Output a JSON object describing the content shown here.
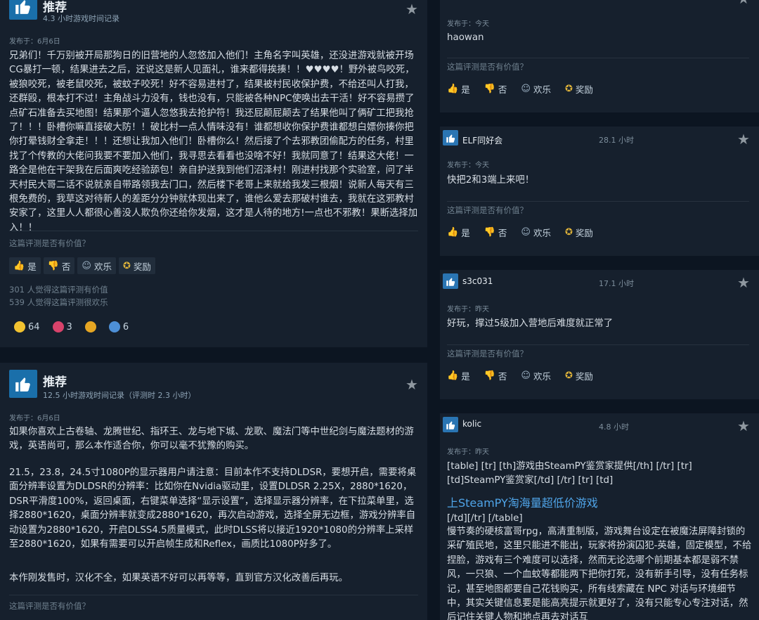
{
  "left": {
    "review1": {
      "recommend": "推荐",
      "hours": "4.3 小时游戏时间记录",
      "posted": "发布于：6月6日",
      "body": "兄弟们！千万别被开局那狗日的旧营地的人忽悠加入他们！主角名字叫英雄，还没进游戏就被开场CG暴打一顿，结果进去之后，还说这是新人见面礼，谁来都得挨揍！！♥♥♥♥！野外被鸟咬死，被狼咬死，被老鼠咬死，被蚊子咬死！好不容易进村了，结果被村民收保护费，不给还叫人打我，还群殴，根本打不过！主角战斗力没有，钱也没有，只能被各种NPC使唤出去干活！好不容易攒了点矿石准备去买地图！结果那个逼人忽悠我去抢护符！我还屁颠屁颠去了结果他叫了俩矿工把我抢了！！！卧槽你嘛直接破大防！！破比村一点人情味没有！谁都想收你保护费谁都想白嫖你揍你把你打晕钱财全拿走！！！还想让我加入他们！卧槽你么！然后接了个去邪教团偷配方的任务，村里找了个传教的大佬问我要不要加入他们，我寻思去看看也没啥不好！我就同意了！结果这大佬！一路全是他在干架我在后面爽吃经验舔包！亲自护送我到他们沼泽村！刚进村找那个实验室，问了半天村民大哥二话不说就亲自带路领我去门口，然后楼下老哥上来就给我发三根烟！说新人每天有三根免费的，我草这对待新人的差距分分钟就体现出来了，谁他么爱去那破村谁去，我就在这邪教村安家了，这里人人都很心善没人欺负你还给你发烟，这才是人待的地方!一点也不邪教！果断选择加入！！",
      "helpful_q": "这篇评测是否有价值？",
      "btn_yes": "是",
      "btn_no": "否",
      "btn_fun": "欢乐",
      "btn_award": "奖励",
      "stat1": "301 人觉得这篇评测有价值",
      "stat2": "539 人觉得这篇评测很欢乐",
      "react1": "64",
      "react2": "3",
      "react4": "6"
    },
    "review2": {
      "recommend": "推荐",
      "hours": "12.5 小时游戏时间记录（评测时 2.3 小时）",
      "posted": "发布于：6月6日",
      "p1": "如果你喜欢上古卷轴、龙腾世纪、指环王、龙与地下城、龙歌、魔法门等中世纪剑与魔法题材的游戏，英语尚可，那么本作适合你，你可以毫不犹豫的购买。",
      "p2": "21.5，23.8，24.5寸1080P的显示器用户请注意：目前本作不支持DLDSR，要想开启，需要将桌面分辨率设置为DLDSR的分辨率：比如你在Nvidia驱动里，设置DLDSR 2.25X，2880*1620，DSR平滑度100%，返回桌面，右键菜单选择“显示设置”，选择显示器分辨率，在下拉菜单里，选择2880*1620，桌面分辨率就变成2880*1620，再次启动游戏，选择全屏无边框，游戏分辨率自动设置为2880*1620，开启DLSS4.5质量模式，此时DLSS将以接近1920*1080的分辨率上采样至2880*1620，如果有需要可以开启帧生成和Reflex，画质比1080P好多了。",
      "p3": "本作刚发售时，汉化不全，如果英语不好可以再等等，直到官方汉化改善后再玩。",
      "helpful_q": "这篇评测是否有价值？"
    }
  },
  "right": {
    "r0": {
      "posted": "发布于：今天",
      "body": "haowan",
      "helpful_q": "这篇评测是否有价值？",
      "btn_yes": "是",
      "btn_no": "否",
      "btn_fun": "欢乐",
      "btn_award": "奖励"
    },
    "r1": {
      "user": "ELF同好会",
      "hours": "28.1 小时",
      "posted": "发布于：今天",
      "body": "快把2和3端上来吧！",
      "helpful_q": "这篇评测是否有价值？",
      "btn_yes": "是",
      "btn_no": "否",
      "btn_fun": "欢乐",
      "btn_award": "奖励"
    },
    "r2": {
      "user": "s3c031",
      "hours": "17.1 小时",
      "posted": "发布于：昨天",
      "body": "好玩，撑过5级加入营地后难度就正常了",
      "helpful_q": "这篇评测是否有价值？",
      "btn_yes": "是",
      "btn_no": "否",
      "btn_fun": "欢乐",
      "btn_award": "奖励"
    },
    "r3": {
      "user": "kolic",
      "hours": "4.8 小时",
      "posted": "发布于：昨天",
      "tags1": "[table] [tr] [th]游戏由SteamPY鉴赏家提供[/th] [/tr] [tr] [td]SteamPY鉴赏家[/td] [/tr] [tr] [td]",
      "link": "上SteamPY淘海量超低价游戏",
      "tags2": "[/td][/tr] [/table]",
      "body": "慢节奏的硬核富哥rpg，高清重制版，游戏舞台设定在被魔法屏障封锁的采矿殖民地，这里只能进不能出，玩家将扮演囚犯-英雄，固定模型，不给捏脸，游戏有三个难度可以选择，然而无论选哪个前期基本都是弱不禁风，一只狼、一个血蚊等都能两下把你打死，没有新手引导，没有任务标记，甚至地图都要自己花钱购买，所有线索藏在 NPC 对话与环境细节中，其实关键信息要是能高亮提示就更好了，没有只能专心专注对话，然后记住关键人物和地点再去对话互"
    }
  },
  "colors": {
    "accent": "#1a6faa",
    "link": "#4fa4e8",
    "award": "#e0b43a"
  }
}
